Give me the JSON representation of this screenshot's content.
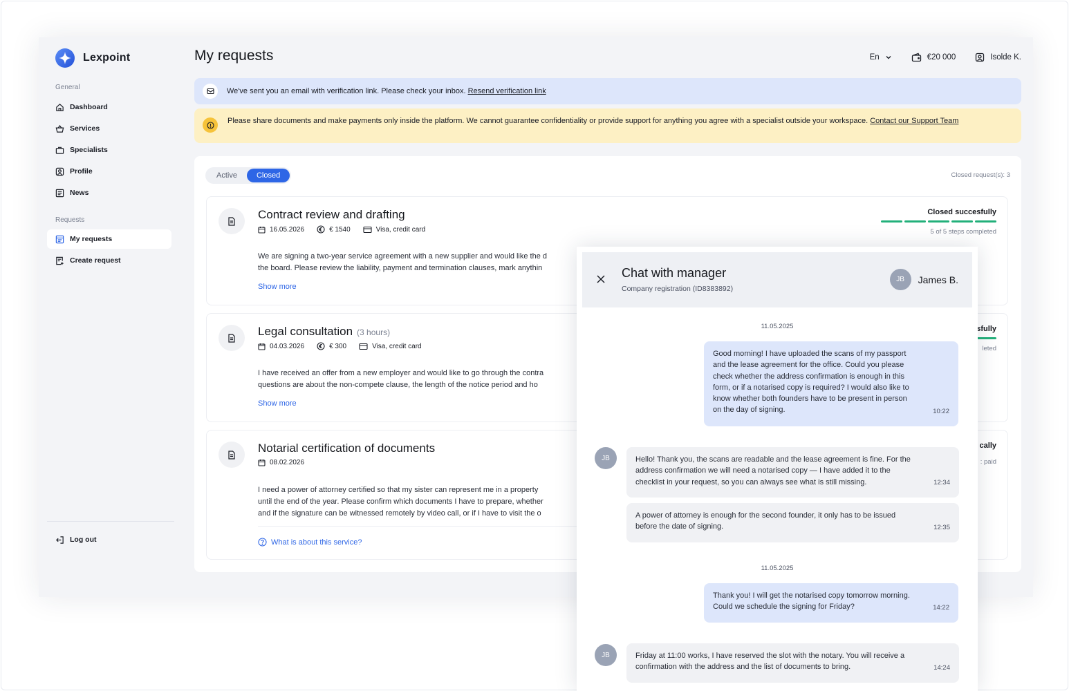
{
  "app": {
    "name": "Lexpoint"
  },
  "sidebar": {
    "general_label": "General",
    "general_items": [
      {
        "label": "Dashboard",
        "icon": "home-icon"
      },
      {
        "label": "Services",
        "icon": "basket-icon"
      },
      {
        "label": "Specialists",
        "icon": "briefcase-icon"
      },
      {
        "label": "Profile",
        "icon": "user-square-icon"
      },
      {
        "label": "News",
        "icon": "news-icon"
      }
    ],
    "requests_label": "Requests",
    "requests_items": [
      {
        "label": "My requests",
        "icon": "list-icon",
        "active": true
      },
      {
        "label": "Create request",
        "icon": "document-add-icon"
      }
    ],
    "logout_label": "Log out"
  },
  "header": {
    "title": "My requests",
    "language": "En",
    "balance": "€20 000",
    "user": "Isolde K."
  },
  "alerts": {
    "verification_text": "We've sent you an email with verification link. Please check your inbox.",
    "verification_link": "Resend verification link",
    "warning_text": "Please share documents and make payments only inside the platform. We cannot guarantee confidentiality or provide support for anything you agree with a specialist outside your workspace.",
    "warning_link": "Contact our Support Team"
  },
  "requests": {
    "tabs": [
      {
        "label": "Active"
      },
      {
        "label": "Closed",
        "active": true
      }
    ],
    "count_label": "Closed request(s): 3",
    "show_more": "Show more",
    "cards": [
      {
        "title": "Contract review and drafting",
        "date": "16.05.2026",
        "price": "€ 1540",
        "payment": "Visa, credit card",
        "desc_line1": "We are signing a two-year service agreement with a new supplier and would like the d",
        "desc_line2": "the board. Please review the liability, payment and termination clauses, mark anythin",
        "status": "Closed succesfully",
        "steps_done": 5,
        "steps_label": "5 of 5 steps completed"
      },
      {
        "title": "Legal consultation",
        "duration": "(3 hours)",
        "date": "04.03.2026",
        "price": "€ 300",
        "payment": "Visa, credit card",
        "desc_line1": "I have received an offer from a new employer and would like to go through the contra",
        "desc_line2": "questions are about the non-compete clause, the length of the notice period and ho",
        "status": "sfully",
        "steps_label": "leted"
      },
      {
        "title": "Notarial certification of documents",
        "date": "08.02.2026",
        "desc_line1": "I need a power of attorney certified so that my sister can represent me in a property",
        "desc_line2": "until the end of the year. Please confirm which documents I have to prepare, whether",
        "desc_line3": "and if the signature can be witnessed remotely by video call, or if I have to visit the o",
        "status": "cally",
        "steps_label": ": paid",
        "what_link": "What is about this service?"
      }
    ]
  },
  "chat": {
    "title": "Chat with manager",
    "subtitle": "Company registration (ID8383892)",
    "manager_initials": "JB",
    "manager_name": "James B.",
    "date1": "11.05.2025",
    "date2": "11.05.2025",
    "messages": [
      {
        "dir": "out",
        "text": "Good morning! I have uploaded the scans of my passport and the lease agreement for the office. Could you please check whether the address confirmation is enough in this form, or if a notarised copy is required? I would also like to know whether both founders have to be present in person on the day of signing.",
        "time": "10:22"
      },
      {
        "dir": "in",
        "text": "Hello! Thank you, the scans are readable and the lease agreement is fine. For the address confirmation we will need a notarised copy — I have added it to the checklist in your request, so you can always see what is still missing.",
        "time": "12:34"
      },
      {
        "dir": "in",
        "text": "A power of attorney is enough for the second founder, it only has to be issued before the date of signing.",
        "time": "12:35"
      },
      {
        "dir": "out",
        "text": "Thank you! I will get the notarised copy tomorrow morning. Could we schedule the signing for Friday?",
        "time": "14:22"
      },
      {
        "dir": "in",
        "text": "Friday at 11:00 works, I have reserved the slot with the notary. You will receive a confirmation with the address and the list of documents to bring.",
        "time": "14:24"
      }
    ]
  },
  "colors": {
    "accent": "#2e66e6",
    "success": "#22b07a",
    "info_bg": "#dde6fb",
    "warning_bg": "#fdf0c4"
  }
}
